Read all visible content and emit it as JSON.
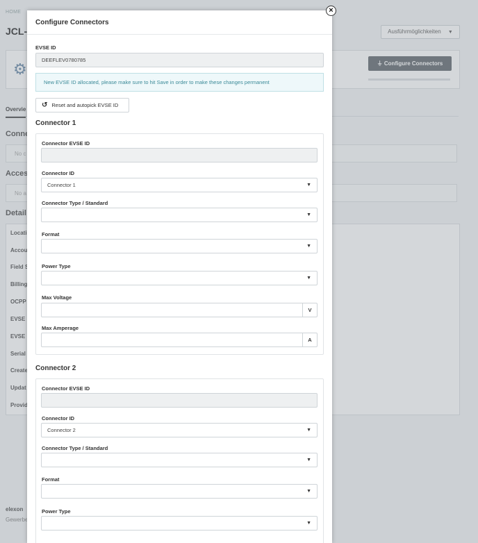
{
  "background": {
    "breadcrumb": "HOME",
    "page_title": "JCL-Z",
    "options_button": "Ausführmöglichkeiten",
    "configure_button": "Configure Connectors",
    "tab_overview": "Overvie",
    "section_connectors": "Conne",
    "connectors_empty": "No c",
    "section_access": "Access",
    "access_empty": "No a",
    "section_details": "Detail",
    "detail_rows": [
      "Locati",
      "Accou",
      "Field S",
      "Billing",
      "OCPP",
      "EVSE I",
      "EVSE I",
      "Serial",
      "Create",
      "Updat",
      "Provid"
    ],
    "footer_company": "elexon",
    "footer_sub": "Gewerbe"
  },
  "modal": {
    "title": "Configure Connectors",
    "close_label": "×",
    "evse_id_label": "EVSE ID",
    "evse_id_value": "DEEFLEV0780785",
    "alert_text": "New EVSE ID allocated, please make sure to hit Save in order to make these changes permanent",
    "reset_button": "Reset and autopick EVSE ID",
    "connectors": [
      {
        "title": "Connector 1",
        "evse_id_label": "Connector EVSE ID",
        "evse_id_value": "",
        "connector_id_label": "Connector ID",
        "connector_id_value": "Connector 1",
        "type_label": "Connector Type / Standard",
        "type_value": "",
        "format_label": "Format",
        "format_value": "",
        "power_type_label": "Power Type",
        "power_type_value": "",
        "max_voltage_label": "Max Voltage",
        "max_voltage_value": "",
        "max_voltage_unit": "V",
        "max_amperage_label": "Max Amperage",
        "max_amperage_value": "",
        "max_amperage_unit": "A"
      },
      {
        "title": "Connector 2",
        "evse_id_label": "Connector EVSE ID",
        "evse_id_value": "",
        "connector_id_label": "Connector ID",
        "connector_id_value": "Connector 2",
        "type_label": "Connector Type / Standard",
        "type_value": "",
        "format_label": "Format",
        "format_value": "",
        "power_type_label": "Power Type",
        "power_type_value": ""
      }
    ]
  }
}
